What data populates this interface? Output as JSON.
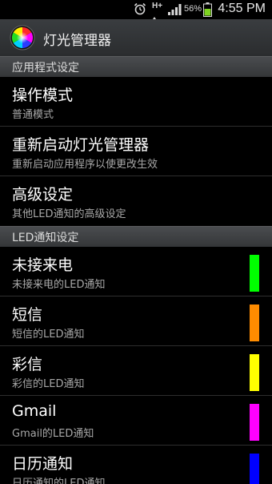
{
  "status_bar": {
    "network": "H+",
    "battery_percent": "56%",
    "time": "4:55 PM"
  },
  "action_bar": {
    "title": "灯光管理器",
    "icon": "color-wheel-icon"
  },
  "sections": [
    {
      "header": "应用程式设定",
      "items": [
        {
          "title": "操作模式",
          "summary": "普通模式"
        },
        {
          "title": "重新启动灯光管理器",
          "summary": "重新启动应用程序以使更改生效"
        },
        {
          "title": "高级设定",
          "summary": "其他LED通知的高级设定"
        }
      ]
    },
    {
      "header": "LED通知设定",
      "items": [
        {
          "title": "未接来电",
          "summary": "未接来电的LED通知",
          "color": "#00ff00"
        },
        {
          "title": "短信",
          "summary": "短信的LED通知",
          "color": "#ff8c00"
        },
        {
          "title": "彩信",
          "summary": "彩信的LED通知",
          "color": "#ffff00"
        },
        {
          "title": "Gmail",
          "summary": "Gmail的LED通知",
          "color": "#ff00ff"
        },
        {
          "title": "日历通知",
          "summary": "日历通知的LED通知",
          "color": "#0000ff"
        }
      ]
    }
  ]
}
